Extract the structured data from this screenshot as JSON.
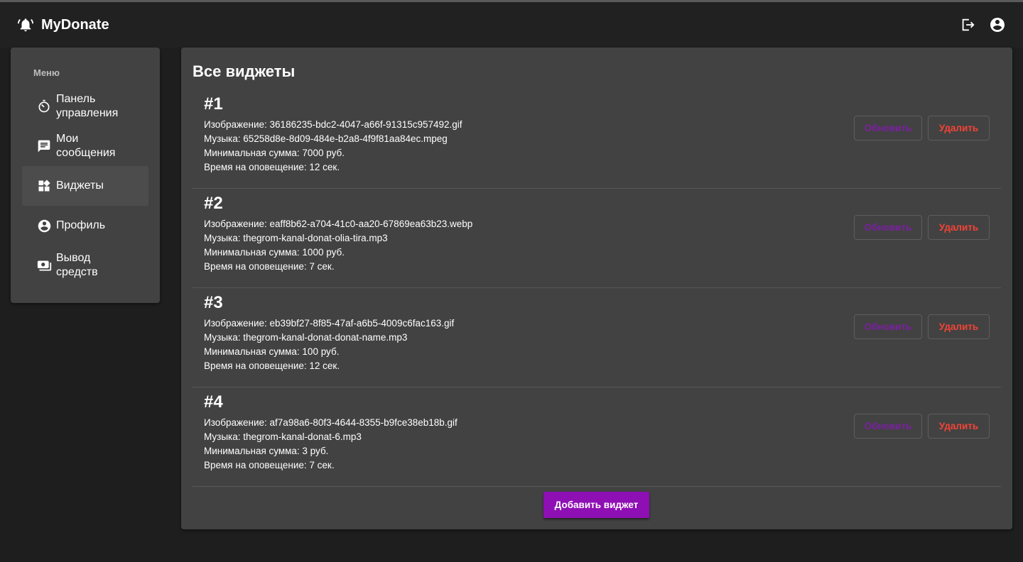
{
  "app": {
    "title": "MyDonate"
  },
  "sidebar": {
    "caption": "Меню",
    "items": [
      {
        "label": "Панель управления",
        "icon": "dashboard-timer-icon"
      },
      {
        "label": "Мои сообщения",
        "icon": "message-icon"
      },
      {
        "label": "Виджеты",
        "icon": "widgets-icon",
        "active": true
      },
      {
        "label": "Профиль",
        "icon": "account-circle-icon"
      },
      {
        "label": "Вывод средств",
        "icon": "payments-icon"
      }
    ]
  },
  "main": {
    "title": "Все виджеты",
    "update_label": "Обновить",
    "delete_label": "Удалить",
    "add_label": "Добавить виджет",
    "widgets": [
      {
        "num": "#1",
        "image": "Изображение: 36186235-bdc2-4047-a66f-91315c957492.gif",
        "music": "Музыка: 65258d8e-8d09-484e-b2a8-4f9f81aa84ec.mpeg",
        "min_sum": "Минимальная сумма: 7000 руб.",
        "time": "Время на оповещение: 12 сек."
      },
      {
        "num": "#2",
        "image": "Изображение: eaff8b62-a704-41c0-aa20-67869ea63b23.webp",
        "music": "Музыка: thegrom-kanal-donat-olia-tira.mp3",
        "min_sum": "Минимальная сумма: 1000 руб.",
        "time": "Время на оповещение: 7 сек."
      },
      {
        "num": "#3",
        "image": "Изображение: eb39bf27-8f85-47af-a6b5-4009c6fac163.gif",
        "music": "Музыка: thegrom-kanal-donat-donat-name.mp3",
        "min_sum": "Минимальная сумма: 100 руб.",
        "time": "Время на оповещение: 12 сек."
      },
      {
        "num": "#4",
        "image": "Изображение: af7a98a6-80f3-4644-8355-b9fce38eb18b.gif",
        "music": "Музыка: thegrom-kanal-donat-6.mp3",
        "min_sum": "Минимальная сумма: 3 руб.",
        "time": "Время на оповещение: 7 сек."
      }
    ]
  },
  "colors": {
    "accent": "#8e0fb4",
    "update_text": "#7b1fa2",
    "delete_text": "#f44336",
    "panel": "#424242",
    "background": "#1e1e1e"
  }
}
